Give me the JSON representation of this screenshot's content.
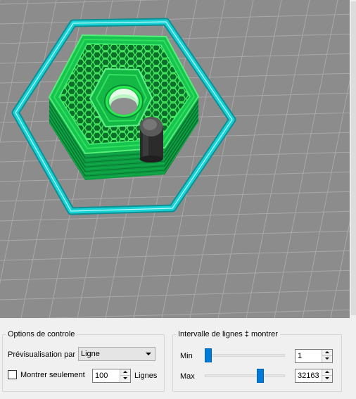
{
  "controls": {
    "options_title": "Options de controle",
    "preview_by_label": "Prévisualisation par",
    "preview_by_value": "Ligne",
    "show_only_label": "Montrer seulement",
    "show_only_checked": false,
    "show_only_value": "100",
    "lines_label": "Lignes"
  },
  "range": {
    "title": "Intervalle de lignes ‡ montrer",
    "min_label": "Min",
    "min_value": "1",
    "min_slider_fraction": 0.0,
    "max_label": "Max",
    "max_value": "32163",
    "max_slider_fraction": 0.71
  },
  "colors": {
    "viewport_bg": "#8c8c8c",
    "grid": "#a9a9a9",
    "skirt": "#16d3d6",
    "part": "#0fa84a",
    "infill": "#38e35d",
    "accent": "#007ad9"
  },
  "icons": [
    "chevron-down-icon",
    "spin-up-icon",
    "spin-down-icon"
  ]
}
